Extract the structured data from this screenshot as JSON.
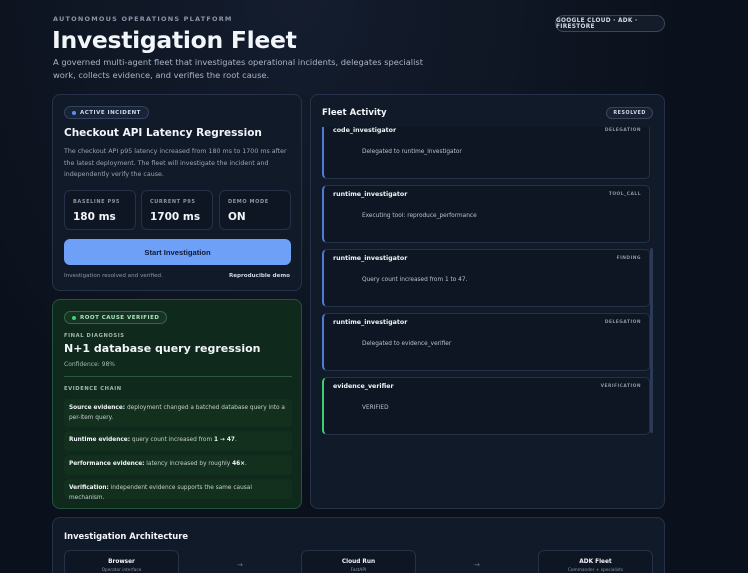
{
  "header": {
    "eyebrow": "AUTONOMOUS OPERATIONS PLATFORM",
    "title": "Investigation Fleet",
    "subtitle": "A governed multi-agent fleet that investigates operational incidents, delegates specialist work, collects evidence, and verifies the root cause.",
    "badge": "GOOGLE CLOUD · ADK · FIRESTORE"
  },
  "incident": {
    "pill": "ACTIVE INCIDENT",
    "title": "Checkout API Latency Regression",
    "description": "The checkout API p95 latency increased from 180 ms to 1700 ms after the latest deployment. The fleet will investigate the incident and independently verify the cause.",
    "metrics": [
      {
        "label": "BASELINE P95",
        "value": "180 ms"
      },
      {
        "label": "CURRENT P95",
        "value": "1700 ms"
      },
      {
        "label": "DEMO MODE",
        "value": "ON"
      }
    ],
    "button_label": "Start Investigation",
    "status": "Investigation resolved and verified.",
    "repro": "Reproducible demo"
  },
  "root_cause": {
    "pill": "ROOT CAUSE VERIFIED",
    "diag_label": "FINAL DIAGNOSIS",
    "title": "N+1 database query regression",
    "confidence": "Confidence: 98%",
    "chain_label": "EVIDENCE CHAIN",
    "evidence": [
      {
        "key": "Source evidence:",
        "text": " deployment changed a batched database query into a per-item query."
      },
      {
        "key": "Runtime evidence:",
        "text": " query count increased from ",
        "strong": "1 → 47",
        "tail": "."
      },
      {
        "key": "Performance evidence:",
        "text": " latency increased by roughly ",
        "strong": "46×",
        "tail": "."
      },
      {
        "key": "Verification:",
        "text": " independent evidence supports the same causal mechanism."
      }
    ]
  },
  "activity": {
    "title": "Fleet Activity",
    "badge": "RESOLVED",
    "events": [
      {
        "agent": "code_investigator",
        "kind": "DELEGATION",
        "message": "Delegated to runtime_investigator",
        "accent": "#4f7ad8"
      },
      {
        "agent": "runtime_investigator",
        "kind": "TOOL_CALL",
        "message": "Executing tool: reproduce_performance",
        "accent": "#4f7ad8"
      },
      {
        "agent": "runtime_investigator",
        "kind": "FINDING",
        "message": "Query count increased from 1 to 47.",
        "accent": "#4f7ad8"
      },
      {
        "agent": "runtime_investigator",
        "kind": "DELEGATION",
        "message": "Delegated to evidence_verifier",
        "accent": "#4f7ad8"
      },
      {
        "agent": "evidence_verifier",
        "kind": "VERIFICATION",
        "message": "VERIFIED",
        "accent": "#3fcf73"
      }
    ]
  },
  "architecture": {
    "title": "Investigation Architecture",
    "nodes": [
      {
        "title": "Browser",
        "sub": "Operator interface"
      },
      {
        "title": "Cloud Run",
        "sub": "FastAPI"
      },
      {
        "title": "ADK Fleet",
        "sub": "Commander + specialists"
      }
    ],
    "arrow": "→"
  }
}
